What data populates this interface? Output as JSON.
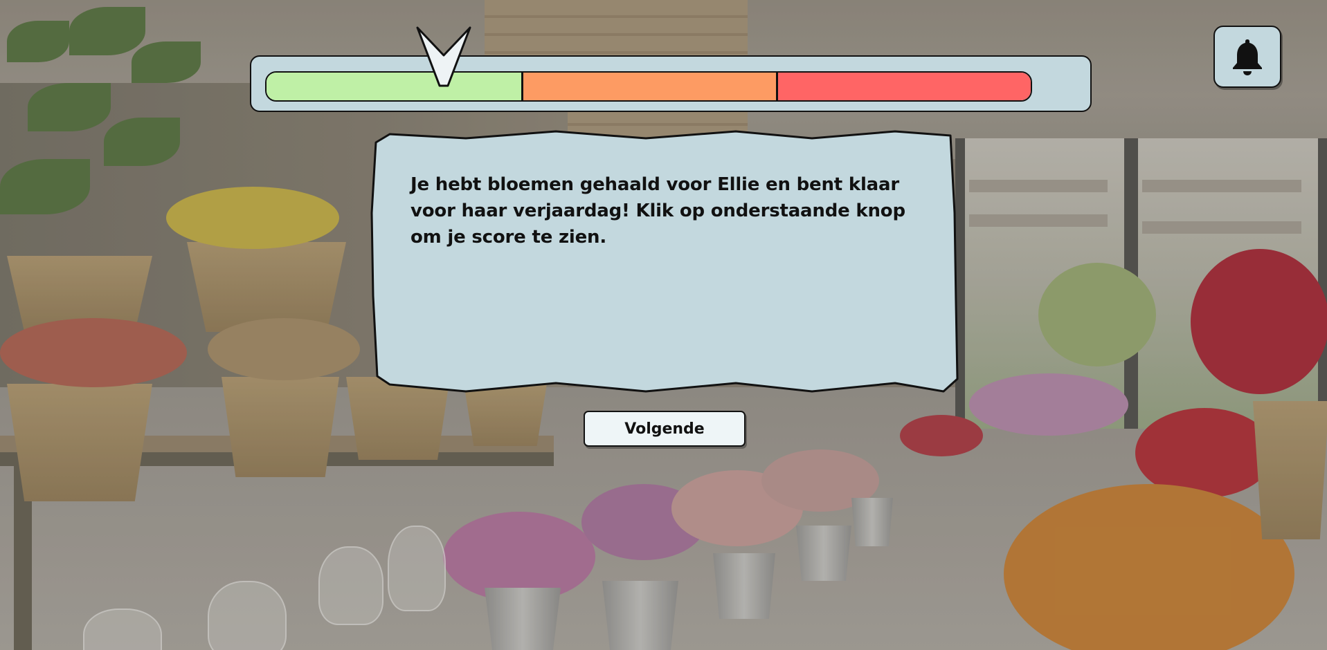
{
  "progress": {
    "segments": [
      {
        "name": "green",
        "color": "#bff0a6",
        "fraction": 0.333
      },
      {
        "name": "orange",
        "color": "#fd9b63",
        "fraction": 0.334
      },
      {
        "name": "red",
        "color": "#ff6565",
        "fraction": 0.333
      }
    ],
    "pointer_position": 0.235
  },
  "bell": {
    "icon": "bell-icon"
  },
  "dialog": {
    "message": "Je hebt bloemen gehaald voor Ellie en bent klaar voor haar verjaardag! Klik op onderstaande knop om je score te zien."
  },
  "next_button": {
    "label": "Volgende"
  },
  "colors": {
    "panel": "#c3d8de",
    "outline": "#111111",
    "button": "#eef5f7"
  }
}
